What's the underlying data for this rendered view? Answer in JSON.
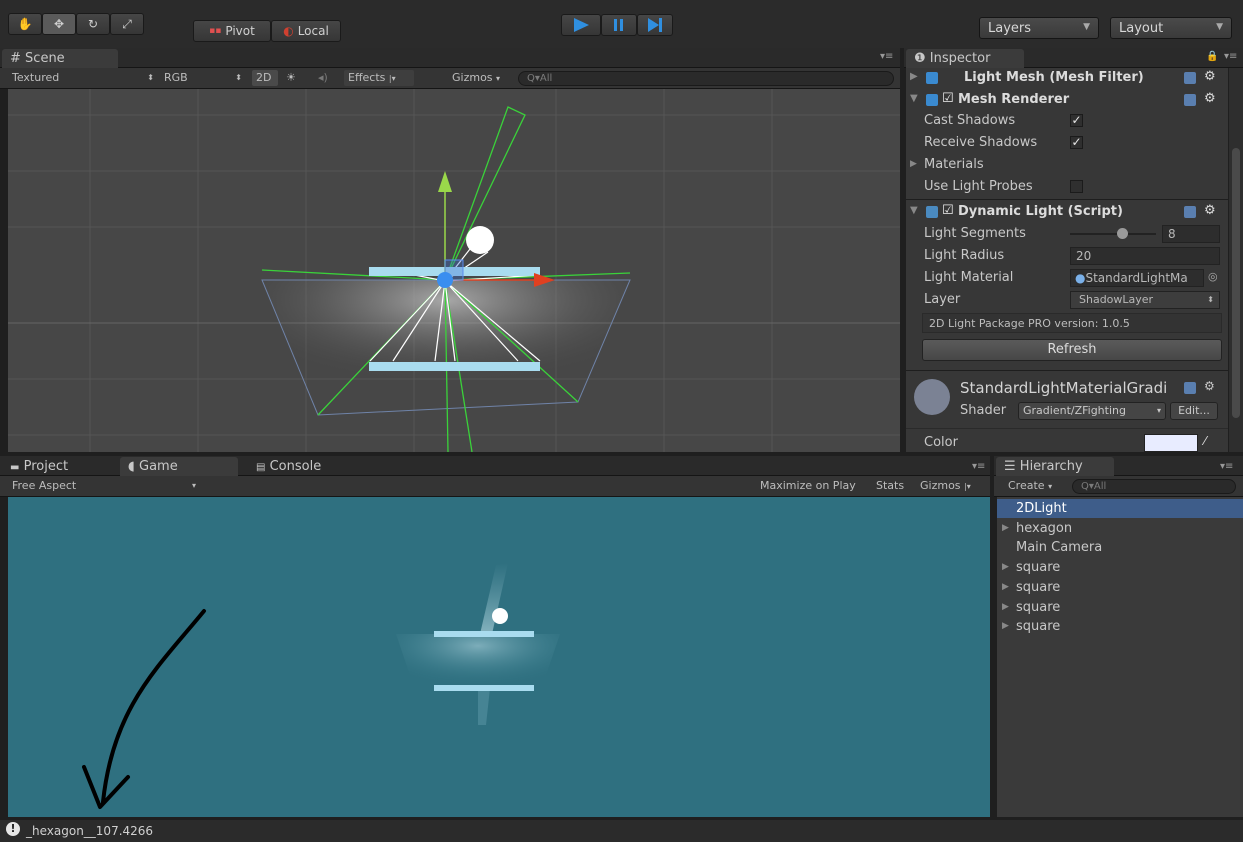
{
  "toolbar": {
    "pivot_label": "Pivot",
    "local_label": "Local",
    "layers_label": "Layers",
    "layout_label": "Layout"
  },
  "scene": {
    "tab_label": "Scene",
    "shading_mode": "Textured",
    "render_mode": "RGB",
    "mode_2d": "2D",
    "effects_label": "Effects",
    "gizmos_label": "Gizmos",
    "search_placeholder": "All"
  },
  "inspector": {
    "tab_label": "Inspector",
    "components": {
      "mesh_filter_title": "Light Mesh (Mesh Filter)",
      "mesh_renderer_title": "Mesh Renderer",
      "cast_shadows_label": "Cast Shadows",
      "receive_shadows_label": "Receive Shadows",
      "materials_label": "Materials",
      "use_light_probes_label": "Use Light Probes",
      "dynamic_light_title": "Dynamic Light (Script)",
      "light_segments_label": "Light Segments",
      "light_segments_value": "8",
      "light_segments_slider": 0.6,
      "light_radius_label": "Light Radius",
      "light_radius_value": "20",
      "light_material_label": "Light Material",
      "light_material_value": "StandardLightMa",
      "layer_label": "Layer",
      "layer_value": "ShadowLayer",
      "version_text": "2D Light Package PRO version: 1.0.5",
      "refresh_label": "Refresh"
    },
    "material": {
      "name": "StandardLightMaterialGradi",
      "shader_label": "Shader",
      "shader_value": "Gradient/ZFighting",
      "edit_label": "Edit...",
      "color_label": "Color",
      "color_swatch": "#e8ecff"
    },
    "states": {
      "cast_shadows": true,
      "receive_shadows": true,
      "use_light_probes": false,
      "mesh_renderer_enabled": true,
      "dynamic_light_enabled": true
    }
  },
  "bottom_tabs": {
    "project_label": "Project",
    "game_label": "Game",
    "console_label": "Console"
  },
  "game": {
    "aspect_label": "Free Aspect",
    "maximize_label": "Maximize on Play",
    "stats_label": "Stats",
    "gizmos_label": "Gizmos",
    "background_color": "#2f7080"
  },
  "hierarchy": {
    "tab_label": "Hierarchy",
    "create_label": "Create",
    "search_placeholder": "All",
    "items": [
      {
        "label": "2DLight",
        "selected": true,
        "expandable": false
      },
      {
        "label": "hexagon",
        "selected": false,
        "expandable": true
      },
      {
        "label": "Main Camera",
        "selected": false,
        "expandable": false
      },
      {
        "label": "square",
        "selected": false,
        "expandable": true
      },
      {
        "label": "square",
        "selected": false,
        "expandable": true
      },
      {
        "label": "square",
        "selected": false,
        "expandable": true
      },
      {
        "label": "square",
        "selected": false,
        "expandable": true
      }
    ]
  },
  "status": {
    "message": "_hexagon__107.4266",
    "icon": "info-icon"
  },
  "colors": {
    "accent_play": "#2f8fe0",
    "selection": "#3e5d8a",
    "gizmo_green": "#3ad23a",
    "gizmo_red": "#e04020",
    "gizmo_axis_green": "#9ad84a",
    "platform": "#a9dcef"
  }
}
